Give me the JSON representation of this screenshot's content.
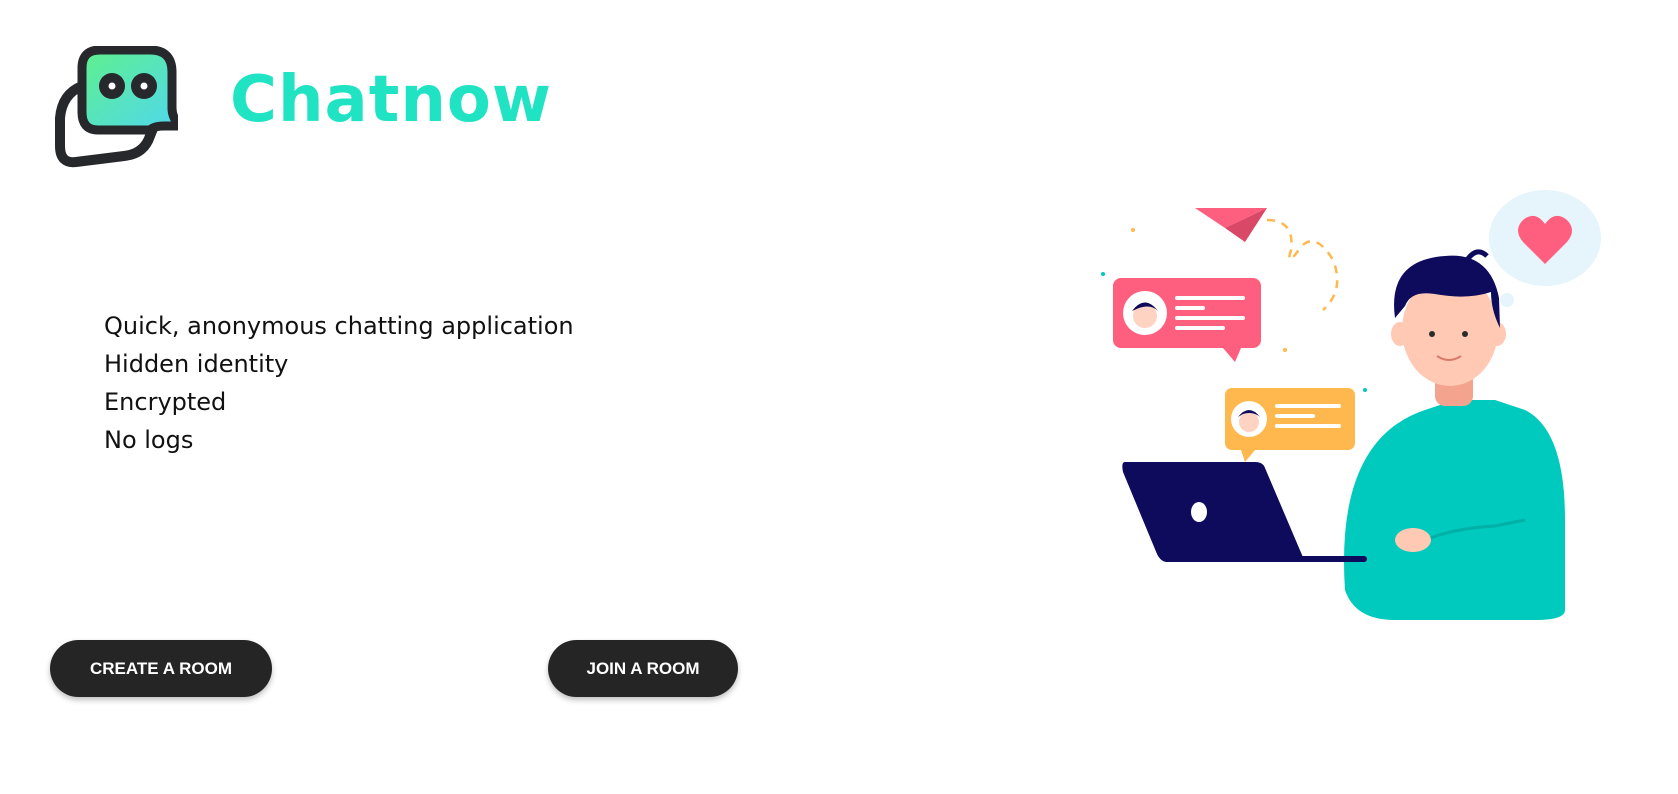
{
  "brand": {
    "name": "Chatnow",
    "accent_color": "#20e3c3",
    "logo_icon": "chat-bubble-face-icon"
  },
  "features": [
    "Quick, anonymous chatting application",
    "Hidden identity",
    "Encrypted",
    "No logs"
  ],
  "actions": {
    "create_label": "CREATE A ROOM",
    "join_label": "JOIN A ROOM",
    "button_color": "#252525"
  },
  "illustration": {
    "icon": "person-chatting-on-laptop-illustration",
    "colors": {
      "pink": "#ff5f7e",
      "orange": "#ffb84d",
      "teal": "#00c9bd",
      "navy": "#0e0a5c"
    }
  }
}
